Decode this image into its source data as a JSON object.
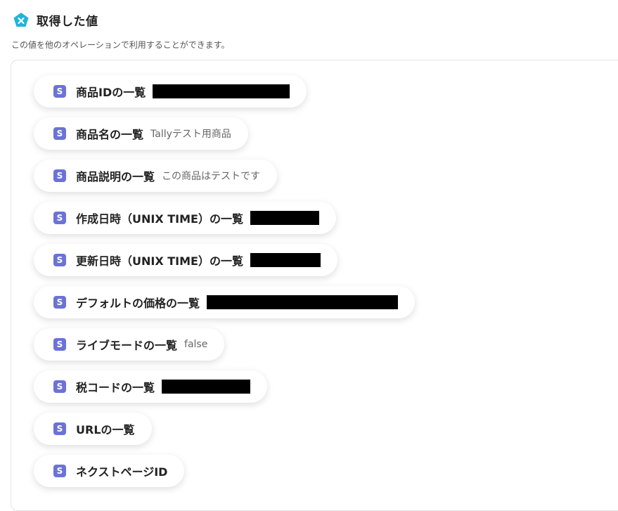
{
  "header": {
    "title": "取得した値",
    "icon": "x-badge-icon",
    "accent": "#1fb5d8"
  },
  "subtitle": "この値を他のオペレーションで利用することができます。",
  "items": [
    {
      "label": "商品IDの一覧",
      "value": "",
      "redacted": true
    },
    {
      "label": "商品名の一覧",
      "value": "Tallyテスト用商品",
      "redacted": false
    },
    {
      "label": "商品説明の一覧",
      "value": "この商品はテストです",
      "redacted": false
    },
    {
      "label": "作成日時（UNIX TIME）の一覧",
      "value": "",
      "redacted": true
    },
    {
      "label": "更新日時（UNIX TIME）の一覧",
      "value": "",
      "redacted": true
    },
    {
      "label": "デフォルトの価格の一覧",
      "value": "",
      "redacted": true
    },
    {
      "label": "ライブモードの一覧",
      "value": "false",
      "redacted": false
    },
    {
      "label": "税コードの一覧",
      "value": "",
      "redacted": true
    },
    {
      "label": "URLの一覧",
      "value": "",
      "redacted": false
    },
    {
      "label": "ネクストページID",
      "value": "",
      "redacted": false
    }
  ],
  "item_icon": {
    "glyph": "S",
    "color": "#6b73d6",
    "name": "stripe-icon"
  }
}
